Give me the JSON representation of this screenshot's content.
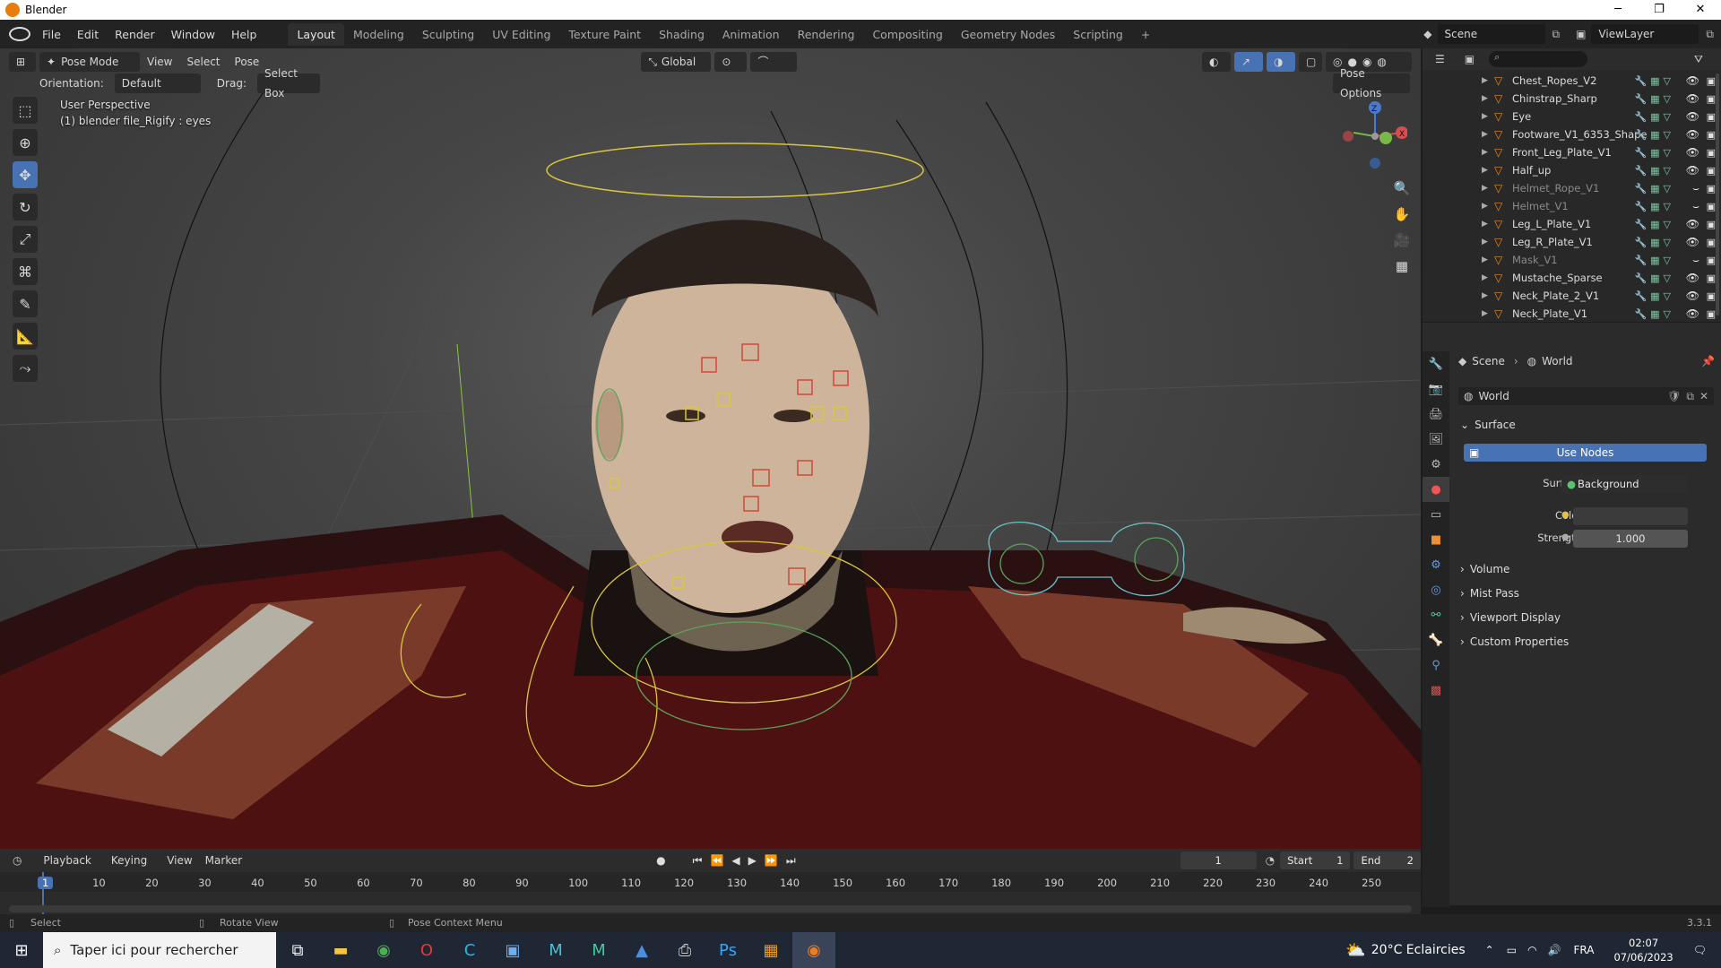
{
  "window": {
    "title": "Blender",
    "minimize": "─",
    "maximize": "❐",
    "close": "✕"
  },
  "menubar": {
    "menus": [
      "File",
      "Edit",
      "Render",
      "Window",
      "Help"
    ],
    "tabs": [
      "Layout",
      "Modeling",
      "Sculpting",
      "UV Editing",
      "Texture Paint",
      "Shading",
      "Animation",
      "Rendering",
      "Compositing",
      "Geometry Nodes",
      "Scripting"
    ],
    "active_tab": "Layout",
    "add_tab": "+",
    "scene": "Scene",
    "view_layer": "ViewLayer"
  },
  "viewport": {
    "mode": "Pose Mode",
    "menus": [
      "View",
      "Select",
      "Pose"
    ],
    "transform_orientation": "Global",
    "orientation_label": "Orientation:",
    "orientation_value": "Default",
    "drag_label": "Drag:",
    "drag_value": "Select Box",
    "pose_options": "Pose Options",
    "info_line1": "User Perspective",
    "info_line2": "(1) blender file_Rigify : eyes",
    "gizmo": {
      "z": "Z",
      "x": "X"
    }
  },
  "outliner": {
    "items": [
      {
        "name": "Chest_Ropes_V2",
        "dim": false
      },
      {
        "name": "Chinstrap_Sharp",
        "dim": false
      },
      {
        "name": "Eye",
        "dim": false
      },
      {
        "name": "Footware_V1_6353_Shape",
        "dim": false
      },
      {
        "name": "Front_Leg_Plate_V1",
        "dim": false
      },
      {
        "name": "Half_up",
        "dim": false
      },
      {
        "name": "Helmet_Rope_V1",
        "dim": true
      },
      {
        "name": "Helmet_V1",
        "dim": true
      },
      {
        "name": "Leg_L_Plate_V1",
        "dim": false
      },
      {
        "name": "Leg_R_Plate_V1",
        "dim": false
      },
      {
        "name": "Mask_V1",
        "dim": true
      },
      {
        "name": "Mustache_Sparse",
        "dim": false
      },
      {
        "name": "Neck_Plate_2_V1",
        "dim": false
      },
      {
        "name": "Neck_Plate_V1",
        "dim": false
      }
    ]
  },
  "properties": {
    "breadcrumb_scene": "Scene",
    "breadcrumb_world": "World",
    "world_name": "World",
    "surface_header": "Surface",
    "use_nodes": "Use Nodes",
    "surface_label": "Surface",
    "surface_value": "Background",
    "color_label": "Color",
    "strength_label": "Strength",
    "strength_value": "1.000",
    "panels": [
      "Volume",
      "Mist Pass",
      "Viewport Display",
      "Custom Properties"
    ]
  },
  "timeline": {
    "menus": [
      "Playback",
      "Keying",
      "View",
      "Marker"
    ],
    "current_frame": "1",
    "start_label": "Start",
    "start_value": "1",
    "end_label": "End",
    "end_value": "2",
    "ruler_labels": [
      "1",
      "10",
      "20",
      "30",
      "40",
      "50",
      "60",
      "70",
      "80",
      "90",
      "100",
      "110",
      "120",
      "130",
      "140",
      "150",
      "160",
      "170",
      "180",
      "190",
      "200",
      "210",
      "220",
      "230",
      "240",
      "250"
    ]
  },
  "statusbar": {
    "select": "Select",
    "rotate": "Rotate View",
    "context": "Pose Context Menu",
    "version": "3.3.1"
  },
  "taskbar": {
    "search_placeholder": "Taper ici pour rechercher",
    "weather": "20°C  Eclaircies",
    "language": "FRA",
    "time": "02:07",
    "date": "07/06/2023"
  }
}
